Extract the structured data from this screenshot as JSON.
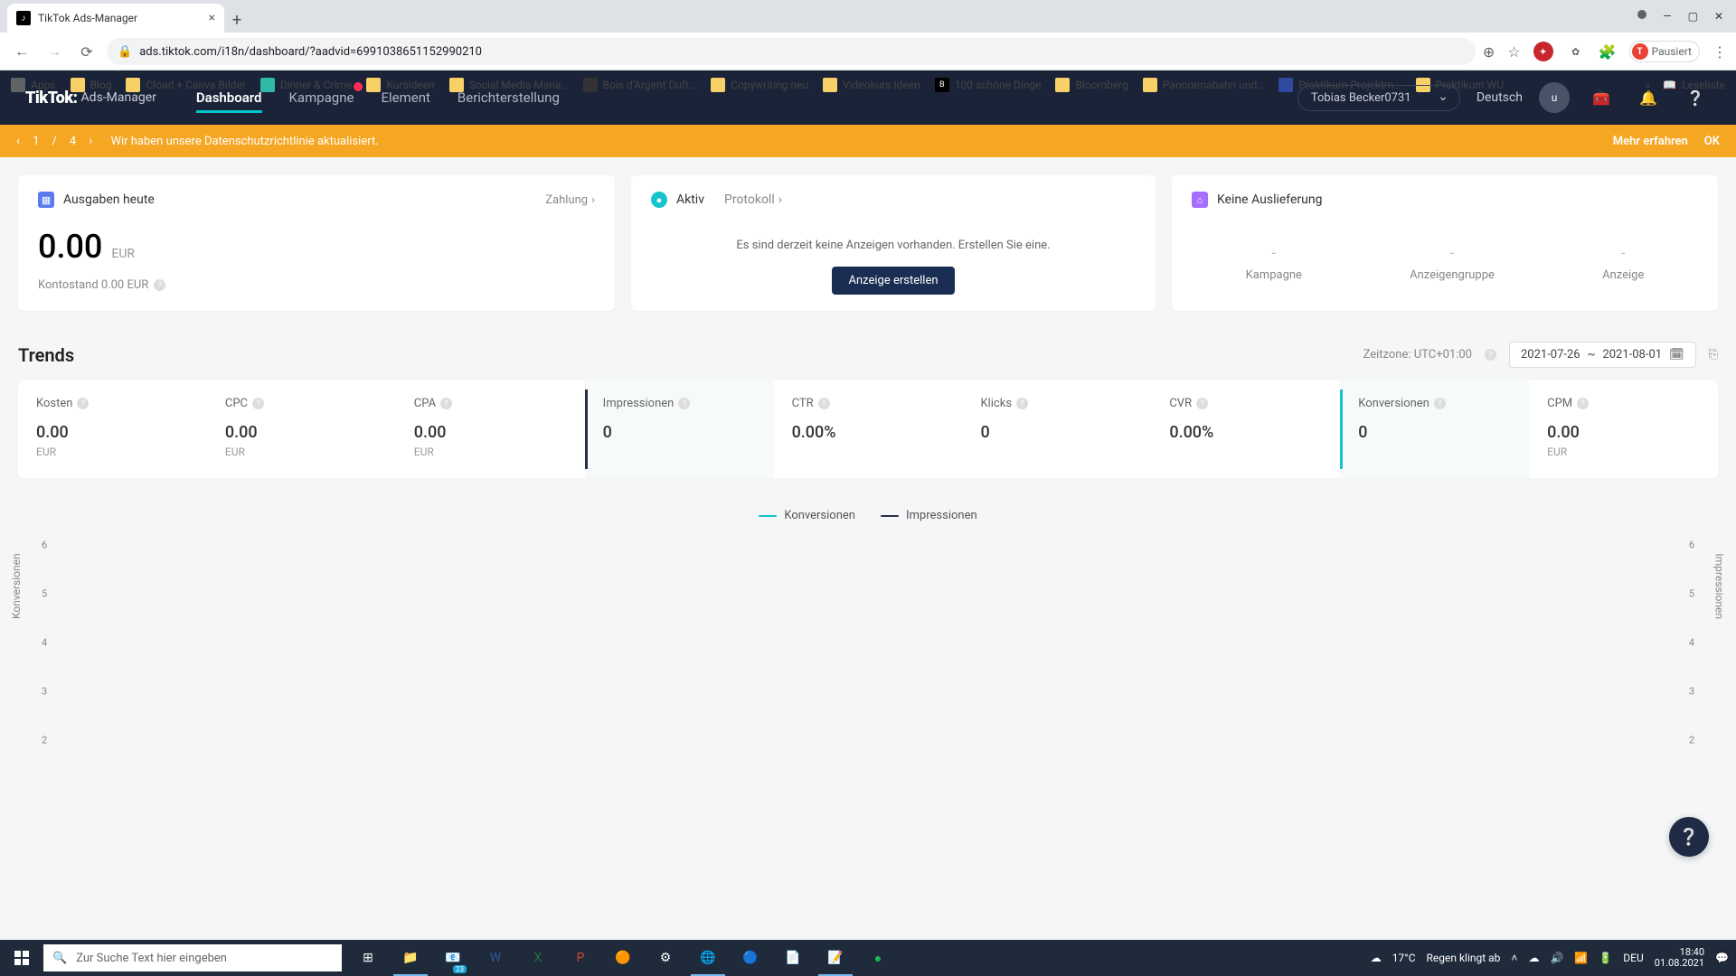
{
  "browser": {
    "tab_title": "TikTok Ads-Manager",
    "url": "ads.tiktok.com/i18n/dashboard/?aadvid=6991038651152990210",
    "profile_status": "Pausiert",
    "profile_initial": "T",
    "bookmarks": [
      "Apps",
      "Blog",
      "Cload + Canva Bilder",
      "Dinner & Crime",
      "Kursideen",
      "Social Media Mana…",
      "Bois d'Argent Duft…",
      "Copywriting neu",
      "Videokurs Ideen",
      "100 schöne Dinge",
      "Bloomberg",
      "Panoramabahn und…",
      "Praktikum Projektm…",
      "Praktikum WU"
    ],
    "reading_list": "Leseliste"
  },
  "header": {
    "logo_main": "TikTok:",
    "logo_sub": "Ads-Manager",
    "nav": [
      "Dashboard",
      "Kampagne",
      "Element",
      "Berichterstellung"
    ],
    "account": "Tobias Becker0731",
    "language": "Deutsch",
    "user_initial": "u"
  },
  "notice": {
    "current": "1",
    "total": "4",
    "message": "Wir haben unsere Datenschutzrichtlinie aktualisiert.",
    "learn_more": "Mehr erfahren",
    "ok": "OK"
  },
  "cards": {
    "spend": {
      "title": "Ausgaben heute",
      "payment_link": "Zahlung",
      "amount": "0.00",
      "currency": "EUR",
      "balance_label": "Kontostand 0.00 EUR"
    },
    "status": {
      "active_label": "Aktiv",
      "log_link": "Protokoll",
      "no_ads_msg": "Es sind derzeit keine Anzeigen vorhanden. Erstellen Sie eine.",
      "create_btn": "Anzeige erstellen"
    },
    "delivery": {
      "title": "Keine Auslieferung",
      "cols": [
        "Kampagne",
        "Anzeigengruppe",
        "Anzeige"
      ]
    }
  },
  "trends": {
    "title": "Trends",
    "timezone_label": "Zeitzone: UTC+01:00",
    "date_from": "2021-07-26",
    "date_sep": "~",
    "date_to": "2021-08-01",
    "metrics": [
      {
        "label": "Kosten",
        "value": "0.00",
        "unit": "EUR"
      },
      {
        "label": "CPC",
        "value": "0.00",
        "unit": "EUR"
      },
      {
        "label": "CPA",
        "value": "0.00",
        "unit": "EUR"
      },
      {
        "label": "Impressionen",
        "value": "0",
        "unit": ""
      },
      {
        "label": "CTR",
        "value": "0.00%",
        "unit": ""
      },
      {
        "label": "Klicks",
        "value": "0",
        "unit": ""
      },
      {
        "label": "CVR",
        "value": "0.00%",
        "unit": ""
      },
      {
        "label": "Konversionen",
        "value": "0",
        "unit": ""
      },
      {
        "label": "CPM",
        "value": "0.00",
        "unit": "EUR"
      }
    ],
    "legend": [
      {
        "label": "Konversionen",
        "color": "#17c3ce"
      },
      {
        "label": "Impressionen",
        "color": "#2a2f45"
      }
    ]
  },
  "chart_data": {
    "type": "line",
    "series": [
      {
        "name": "Konversionen",
        "values": []
      },
      {
        "name": "Impressionen",
        "values": []
      }
    ],
    "y_left_label": "Konversionen",
    "y_right_label": "Impressionen",
    "y_ticks_left": [
      6,
      5,
      4,
      3,
      2
    ],
    "y_ticks_right": [
      6,
      5,
      4,
      3,
      2
    ],
    "ylim": [
      2,
      6
    ]
  },
  "taskbar": {
    "search_placeholder": "Zur Suche Text hier eingeben",
    "weather_temp": "17°C",
    "weather_text": "Regen klingt ab",
    "lang": "DEU",
    "time": "18:40",
    "date": "01.08.2021"
  }
}
